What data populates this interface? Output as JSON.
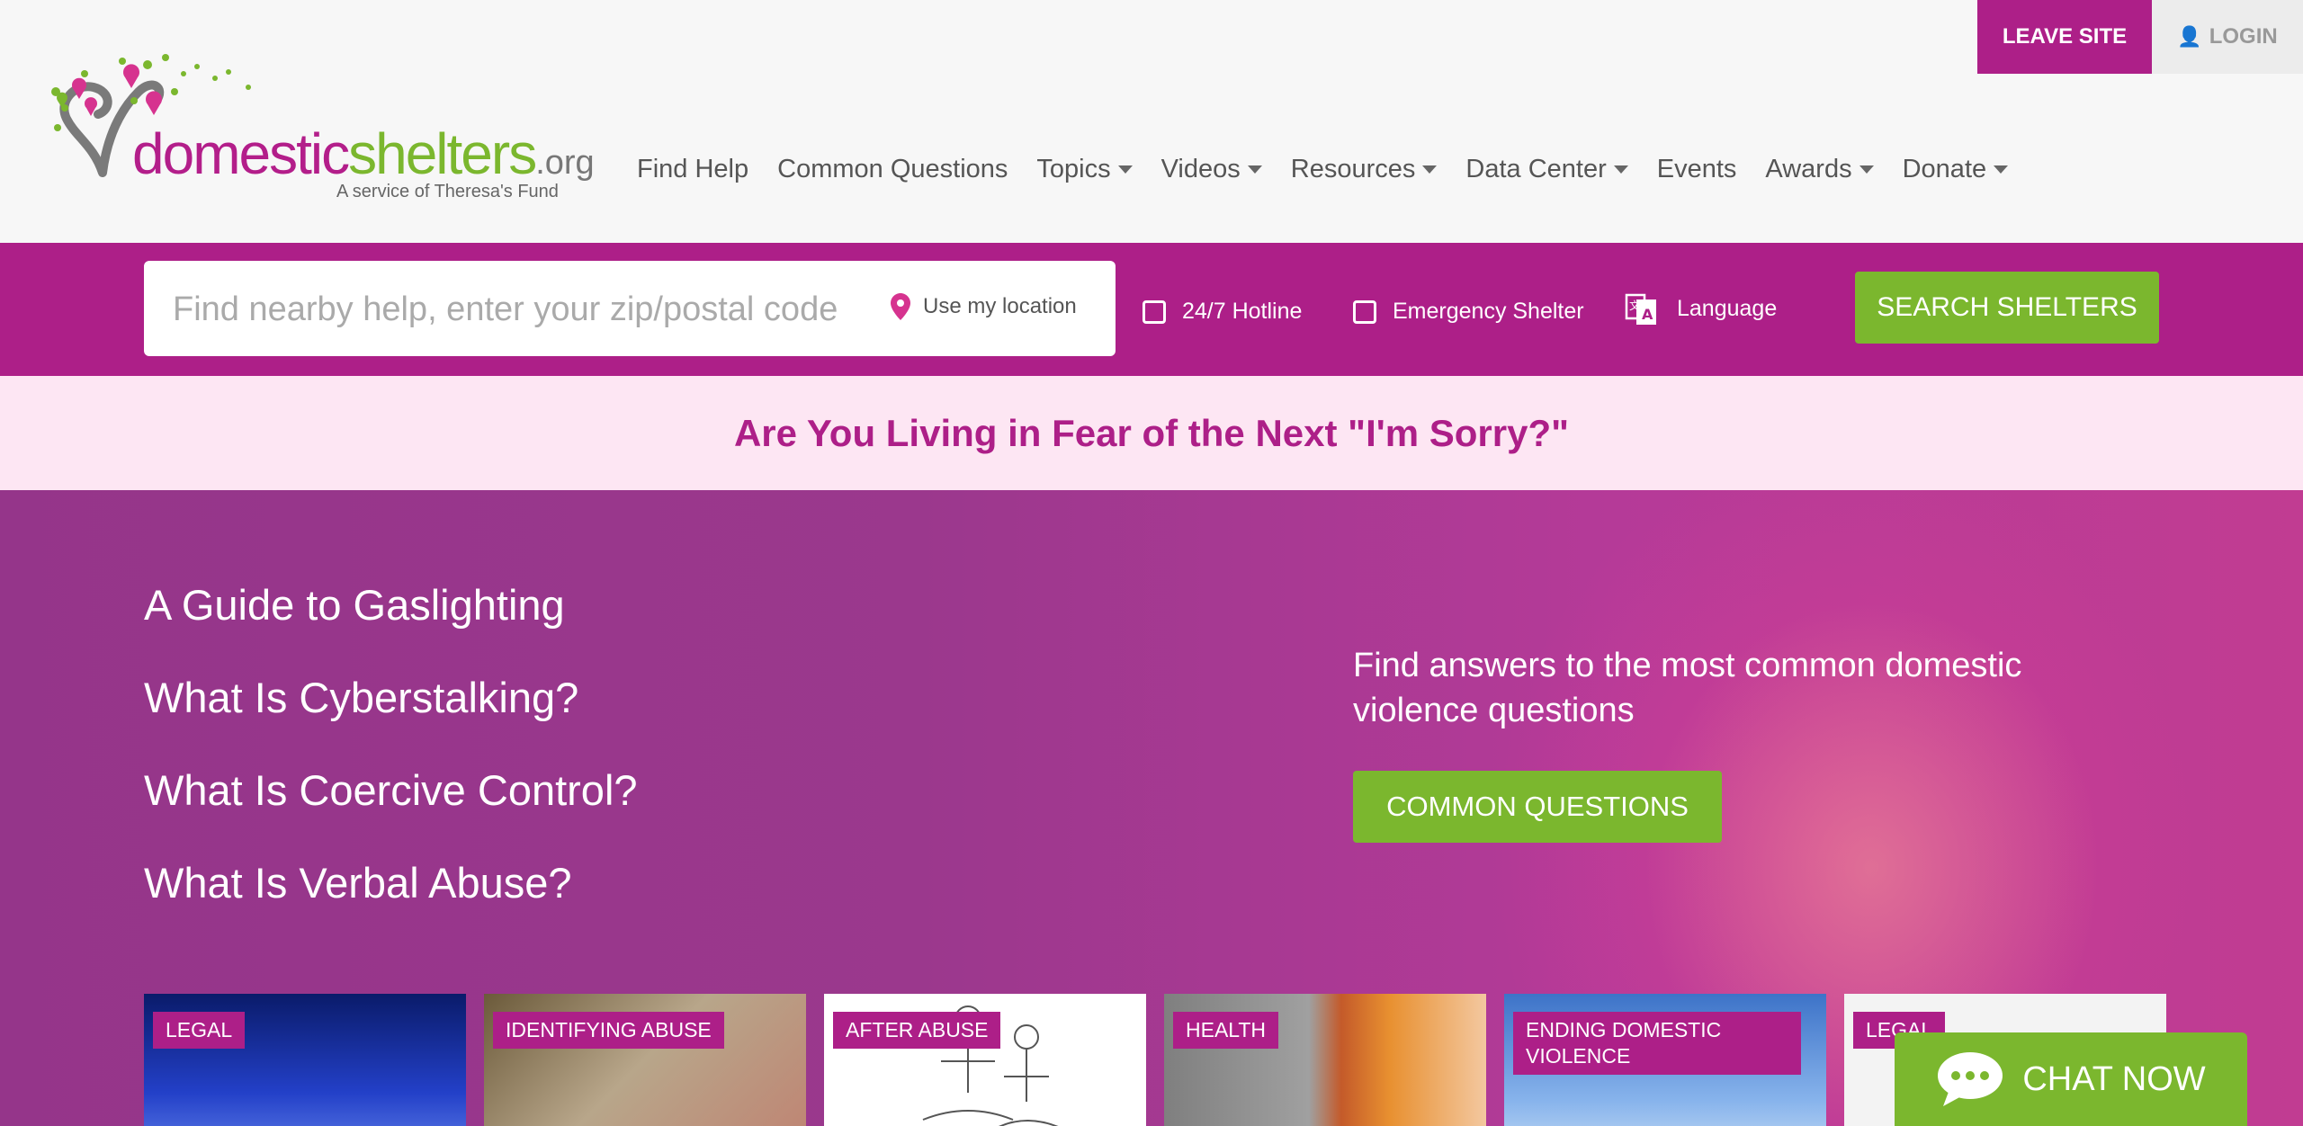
{
  "header": {
    "logo": {
      "part1": "domestic",
      "part2": "shelters",
      "part3": ".org",
      "tagline": "A service of Theresa's Fund"
    },
    "leave_site": "LEAVE SITE",
    "login": "LOGIN",
    "nav": [
      {
        "label": "Find Help",
        "dropdown": false
      },
      {
        "label": "Common Questions",
        "dropdown": false
      },
      {
        "label": "Topics",
        "dropdown": true
      },
      {
        "label": "Videos",
        "dropdown": true
      },
      {
        "label": "Resources",
        "dropdown": true
      },
      {
        "label": "Data Center",
        "dropdown": true
      },
      {
        "label": "Events",
        "dropdown": false
      },
      {
        "label": "Awards",
        "dropdown": true
      },
      {
        "label": "Donate",
        "dropdown": true
      }
    ]
  },
  "search": {
    "placeholder": "Find nearby help, enter your zip/postal code",
    "use_location": "Use my location",
    "hotline_label": "24/7 Hotline",
    "emergency_label": "Emergency Shelter",
    "language_label": "Language",
    "button": "SEARCH SHELTERS"
  },
  "banner": {
    "text": "Are You Living in Fear of the Next \"I'm Sorry?\""
  },
  "hero": {
    "links": [
      "A Guide to Gaslighting",
      "What Is Cyberstalking?",
      "What Is Coercive Control?",
      "What Is Verbal Abuse?"
    ],
    "right_text": "Find answers to the most common domestic violence questions",
    "button": "COMMON QUESTIONS"
  },
  "cards": [
    {
      "tag": "LEGAL"
    },
    {
      "tag": "IDENTIFYING ABUSE"
    },
    {
      "tag": "AFTER ABUSE"
    },
    {
      "tag": "HEALTH"
    },
    {
      "tag": "ENDING DOMESTIC VIOLENCE"
    },
    {
      "tag": "LEGAL"
    }
  ],
  "chat": {
    "label": "CHAT NOW"
  },
  "colors": {
    "brand_magenta": "#ad1f88",
    "brand_green": "#7bb72e",
    "banner_bg": "#fde6f3"
  }
}
